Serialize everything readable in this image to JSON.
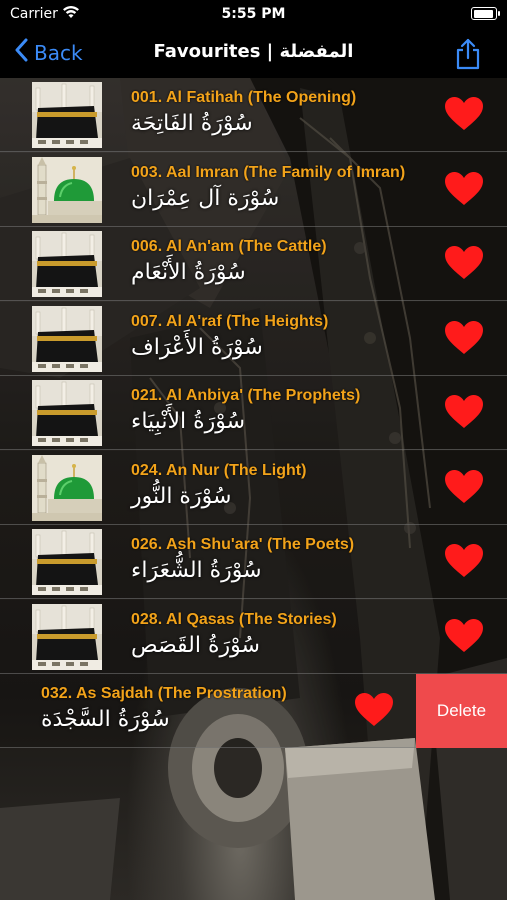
{
  "status_bar": {
    "carrier": "Carrier",
    "time": "5:55 PM"
  },
  "nav": {
    "back_label": "Back",
    "title": "Favourites | المفضلة"
  },
  "surahs": [
    {
      "name": "001. Al Fatihah (The Opening)",
      "arabic": "سُوْرَةُ الفَاتِحَة",
      "thumb": "kaaba"
    },
    {
      "name": "003. Aal Imran (The Family of Imran)",
      "arabic": "سُوْرَة آل عِمْرَان",
      "thumb": "green-dome"
    },
    {
      "name": "006. Al An'am (The Cattle)",
      "arabic": "سُوْرَةُ الأَنْعَام",
      "thumb": "kaaba"
    },
    {
      "name": "007. Al A'raf (The Heights)",
      "arabic": "سُوْرَةُ الأَعْرَاف",
      "thumb": "kaaba"
    },
    {
      "name": "021. Al Anbiya' (The Prophets)",
      "arabic": "سُوْرَةُ الأَنْبِيَاء",
      "thumb": "kaaba"
    },
    {
      "name": "024. An Nur (The Light)",
      "arabic": "سُوْرَة النُّور",
      "thumb": "green-dome"
    },
    {
      "name": "026. Ash Shu'ara' (The Poets)",
      "arabic": "سُوْرَةُ الشُّعَرَاء",
      "thumb": "kaaba"
    },
    {
      "name": "028. Al Qasas (The Stories)",
      "arabic": "سُوْرَةُ القَصَص",
      "thumb": "kaaba"
    },
    {
      "name": "032. As Sajdah (The Prostration)",
      "arabic": "سُوْرَةُ السَّجْدَة",
      "thumb": "kaaba"
    }
  ],
  "delete_label": "Delete",
  "colors": {
    "accent": "#3b8bf7",
    "surah_name": "#f2a31a",
    "heart": "#ff1b1b",
    "delete": "#ef4a4c"
  }
}
